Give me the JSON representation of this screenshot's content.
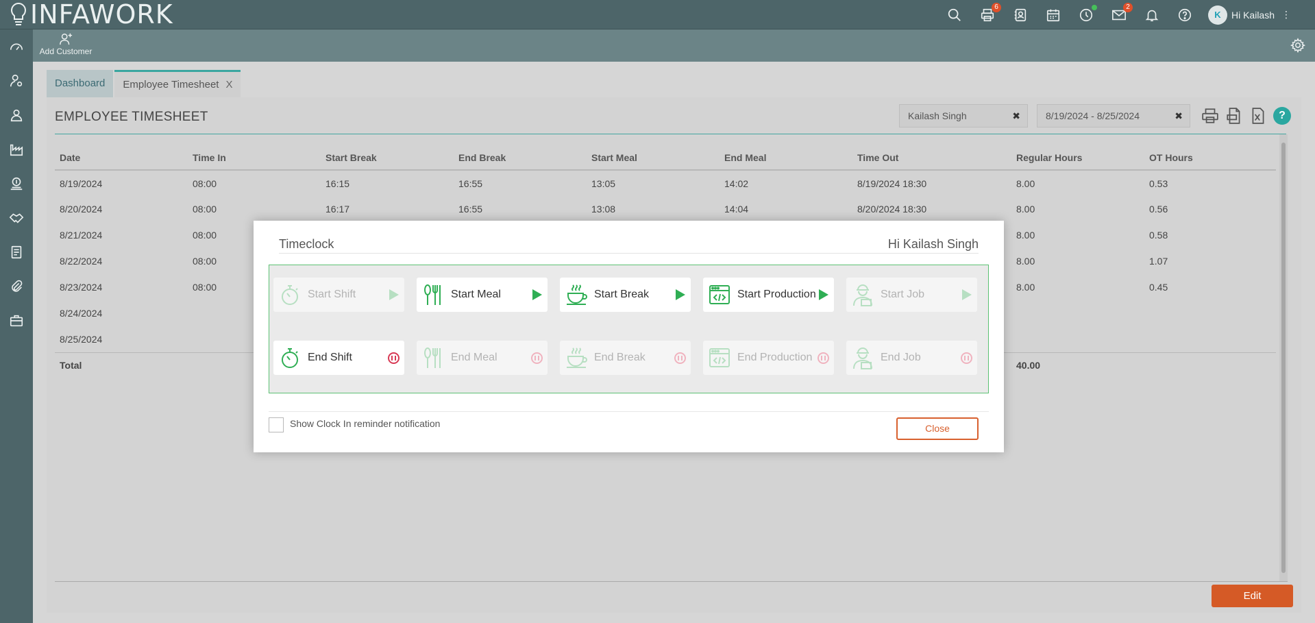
{
  "app": {
    "logo_text": "INFAWORK"
  },
  "header": {
    "badges": {
      "printer": "6",
      "mail": "2"
    },
    "user_greeting": "Hi Kailash",
    "avatar_letter": "K"
  },
  "subbar": {
    "add_customer_label": "Add Customer"
  },
  "tabs": [
    {
      "label": "Dashboard"
    },
    {
      "label": "Employee Timesheet",
      "close": "X"
    }
  ],
  "page": {
    "title": "EMPLOYEE TIMESHEET",
    "filters": {
      "employee": "Kailash Singh",
      "date_range": "8/19/2024 - 8/25/2024",
      "clear_glyph": "✖"
    },
    "help_glyph": "?"
  },
  "table": {
    "columns": [
      "Date",
      "Time In",
      "Start Break",
      "End Break",
      "Start Meal",
      "End Meal",
      "Time Out",
      "Regular Hours",
      "OT Hours"
    ],
    "rows": [
      [
        "8/19/2024",
        "08:00",
        "16:15",
        "16:55",
        "13:05",
        "14:02",
        "8/19/2024 18:30",
        "8.00",
        "0.53"
      ],
      [
        "8/20/2024",
        "08:00",
        "16:17",
        "16:55",
        "13:08",
        "14:04",
        "8/20/2024 18:30",
        "8.00",
        "0.56"
      ],
      [
        "8/21/2024",
        "08:00",
        "",
        "",
        "",
        "",
        "",
        "8.00",
        "0.58"
      ],
      [
        "8/22/2024",
        "08:00",
        "",
        "",
        "",
        "",
        "",
        "8.00",
        "1.07"
      ],
      [
        "8/23/2024",
        "08:00",
        "",
        "",
        "",
        "",
        "",
        "8.00",
        "0.45"
      ],
      [
        "8/24/2024",
        "",
        "",
        "",
        "",
        "",
        "",
        "",
        ""
      ],
      [
        "8/25/2024",
        "",
        "",
        "",
        "",
        "",
        "",
        "",
        ""
      ]
    ],
    "total": {
      "label": "Total",
      "regular_hours": "40.00"
    }
  },
  "edit_button": "Edit",
  "modal": {
    "title": "Timeclock",
    "greeting": "Hi Kailash Singh",
    "actions": [
      {
        "label": "Start Shift",
        "icon": "stopwatch-icon",
        "type": "start",
        "enabled": false
      },
      {
        "label": "Start Meal",
        "icon": "cutlery-icon",
        "type": "start",
        "enabled": true
      },
      {
        "label": "Start Break",
        "icon": "coffee-cup-icon",
        "type": "start",
        "enabled": true
      },
      {
        "label": "Start Production",
        "icon": "code-window-icon",
        "type": "start",
        "enabled": true
      },
      {
        "label": "Start Job",
        "icon": "worker-icon",
        "type": "start",
        "enabled": false
      },
      {
        "label": "End Shift",
        "icon": "stopwatch-icon",
        "type": "end",
        "enabled": true
      },
      {
        "label": "End Meal",
        "icon": "cutlery-icon",
        "type": "end",
        "enabled": false
      },
      {
        "label": "End Break",
        "icon": "coffee-cup-icon",
        "type": "end",
        "enabled": false
      },
      {
        "label": "End Production",
        "icon": "code-window-icon",
        "type": "end",
        "enabled": false
      },
      {
        "label": "End Job",
        "icon": "worker-icon",
        "type": "end",
        "enabled": false
      }
    ],
    "reminder_label": "Show Clock In reminder notification",
    "close_label": "Close"
  },
  "colors": {
    "accent": "#2fae54",
    "brand": "#4d6569",
    "edit": "#d55a26",
    "stop": "#d83a55"
  }
}
